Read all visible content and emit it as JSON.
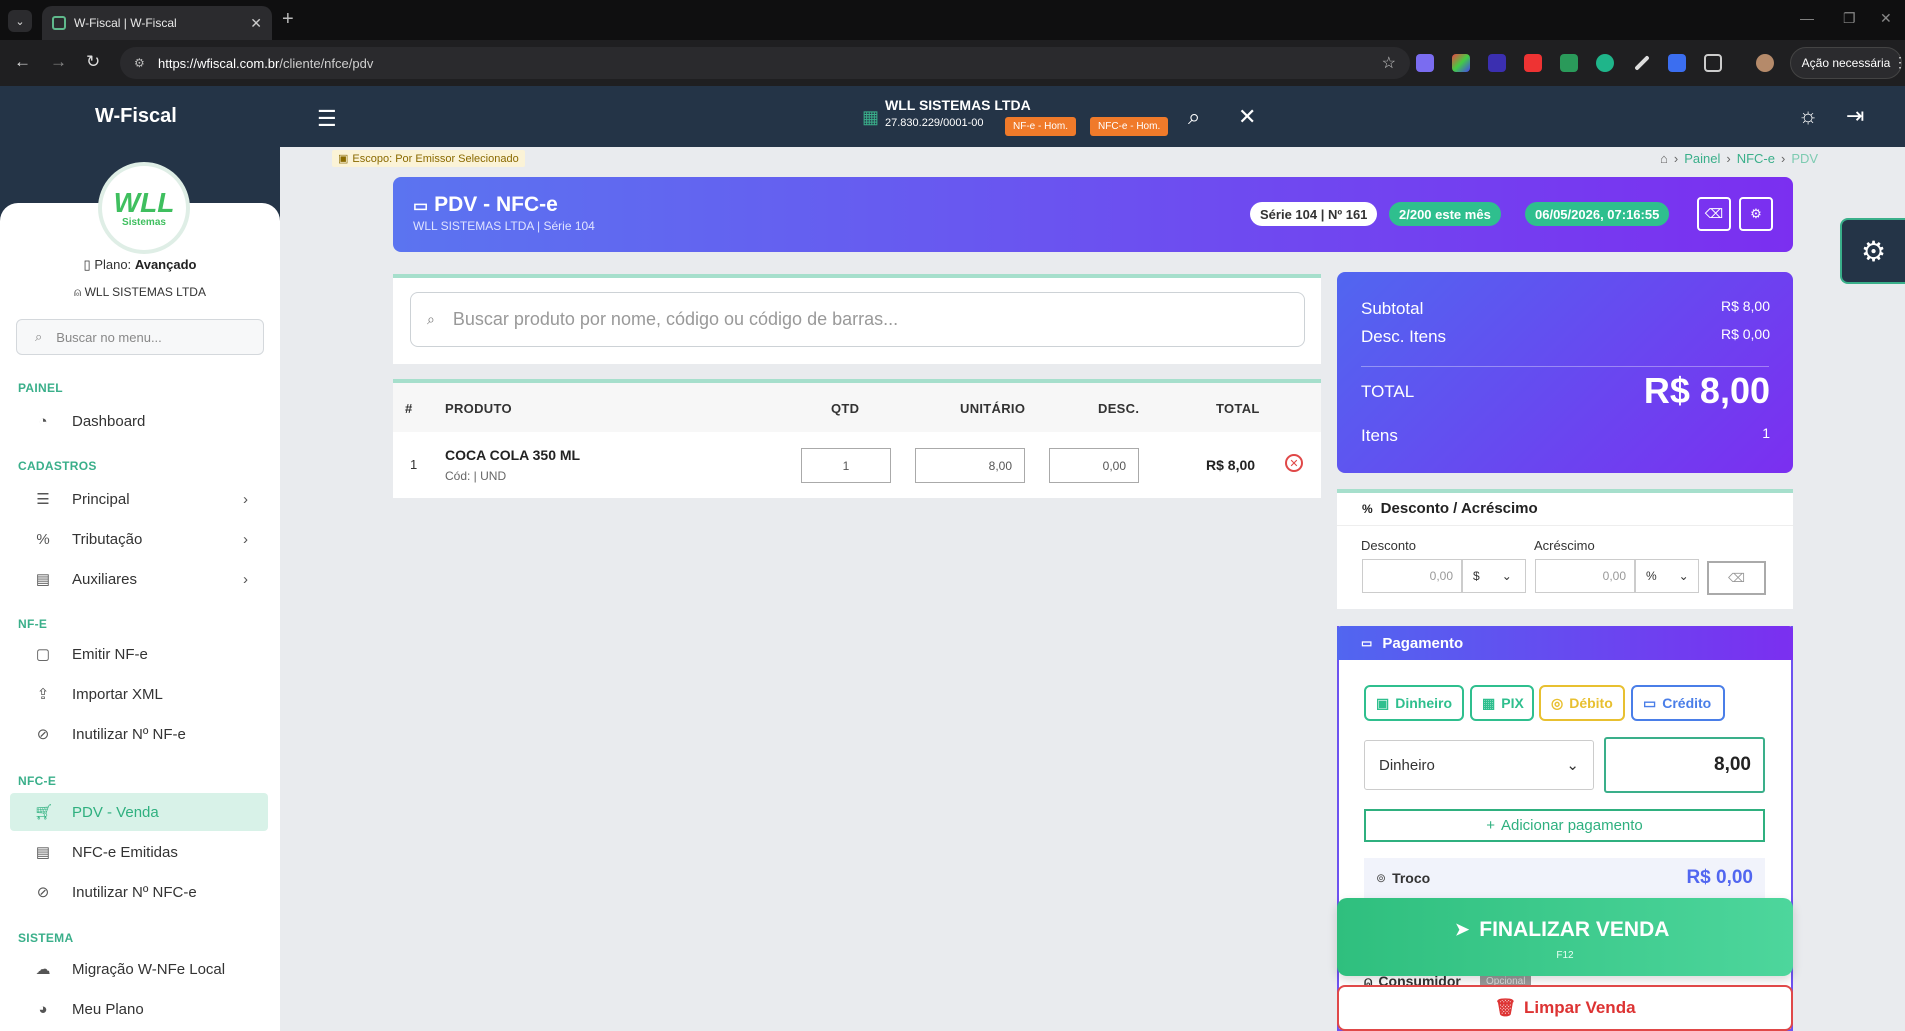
{
  "browser": {
    "tab_title": "W-Fiscal | W-Fiscal",
    "url_host": "https://wfiscal.com.br",
    "url_path": "/cliente/nfce/pdv",
    "action_button": "Ação necessária"
  },
  "header": {
    "brand": "W-Fiscal",
    "company_name": "WLL SISTEMAS LTDA",
    "company_cnpj": "27.830.229/0001-00",
    "badge_nfe": "NF-e - Hom.",
    "badge_nfce": "NFC-e - Hom."
  },
  "sidebar": {
    "logo_text": "WLL",
    "logo_sub": "Sistemas",
    "plan_label": "Plano:",
    "plan_value": "Avançado",
    "owner": "WLL SISTEMAS LTDA",
    "search_placeholder": "Buscar no menu...",
    "sections": {
      "painel": "PAINEL",
      "cadastros": "CADASTROS",
      "nfe": "NF-E",
      "nfce": "NFC-E",
      "sistema": "SISTEMA"
    },
    "items": {
      "dashboard": "Dashboard",
      "principal": "Principal",
      "tributacao": "Tributação",
      "auxiliares": "Auxiliares",
      "emitir_nfe": "Emitir NF-e",
      "importar_xml": "Importar XML",
      "inutilizar_nfe": "Inutilizar Nº NF-e",
      "pdv_venda": "PDV - Venda",
      "nfce_emitidas": "NFC-e Emitidas",
      "inutilizar_nfce": "Inutilizar Nº NFC-e",
      "migracao": "Migração W-NFe Local",
      "meu_plano": "Meu Plano"
    }
  },
  "main": {
    "scope": "Escopo: Por Emissor Selecionado",
    "breadcrumb": [
      "Painel",
      "NFC-e",
      "PDV"
    ],
    "pdv_title": "PDV - NFC-e",
    "pdv_subtitle": "WLL SISTEMAS LTDA | Série 104",
    "serie_pill": "Série 104 | Nº 161",
    "month_pill": "2/200 este mês",
    "date_pill": "06/05/2026, 07:16:55",
    "product_search_placeholder": "Buscar produto por nome, código ou código de barras...",
    "table": {
      "headers": [
        "#",
        "PRODUTO",
        "QTD",
        "UNITÁRIO",
        "DESC.",
        "TOTAL"
      ],
      "rows": [
        {
          "num": "1",
          "product": "COCA COLA 350 ML",
          "sub": "Cód: | UND",
          "qtd": "1",
          "unit": "8,00",
          "desc": "0,00",
          "total": "R$ 8,00"
        }
      ]
    }
  },
  "totals": {
    "subtotal_label": "Subtotal",
    "subtotal_value": "R$ 8,00",
    "desc_label": "Desc. Itens",
    "desc_value": "R$ 0,00",
    "total_label": "TOTAL",
    "total_value": "R$ 8,00",
    "items_label": "Itens",
    "items_value": "1"
  },
  "discount": {
    "title": "Desconto / Acréscimo",
    "desconto_label": "Desconto",
    "acrescimo_label": "Acréscimo",
    "desconto_value": "0,00",
    "acrescimo_value": "0,00",
    "desconto_unit": "$",
    "acrescimo_unit": "%"
  },
  "payment": {
    "title": "Pagamento",
    "methods": [
      "Dinheiro",
      "PIX",
      "Débito",
      "Crédito"
    ],
    "selected_method": "Dinheiro",
    "amount": "8,00",
    "add_payment": "Adicionar pagamento",
    "troco_label": "Troco",
    "troco_value": "R$ 0,00",
    "consumidor_label": "Consumidor",
    "consumidor_tag": "Opcional"
  },
  "actions": {
    "finalizar": "FINALIZAR VENDA",
    "finalizar_key": "F12",
    "limpar": "Limpar Venda"
  },
  "colors": {
    "brand_dark": "#243447",
    "accent_green": "#3aaf8a",
    "purple": "#7b2ff0",
    "danger": "#e04848"
  }
}
